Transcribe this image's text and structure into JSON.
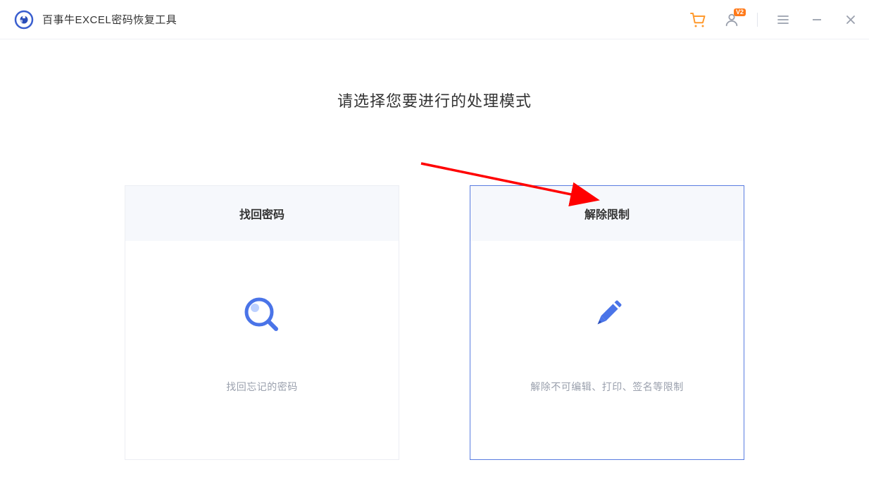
{
  "app": {
    "title": "百事牛EXCEL密码恢复工具",
    "user_badge": "V2"
  },
  "main": {
    "heading": "请选择您要进行的处理模式",
    "cards": [
      {
        "title": "找回密码",
        "desc": "找回忘记的密码"
      },
      {
        "title": "解除限制",
        "desc": "解除不可编辑、打印、签名等限制"
      }
    ]
  }
}
